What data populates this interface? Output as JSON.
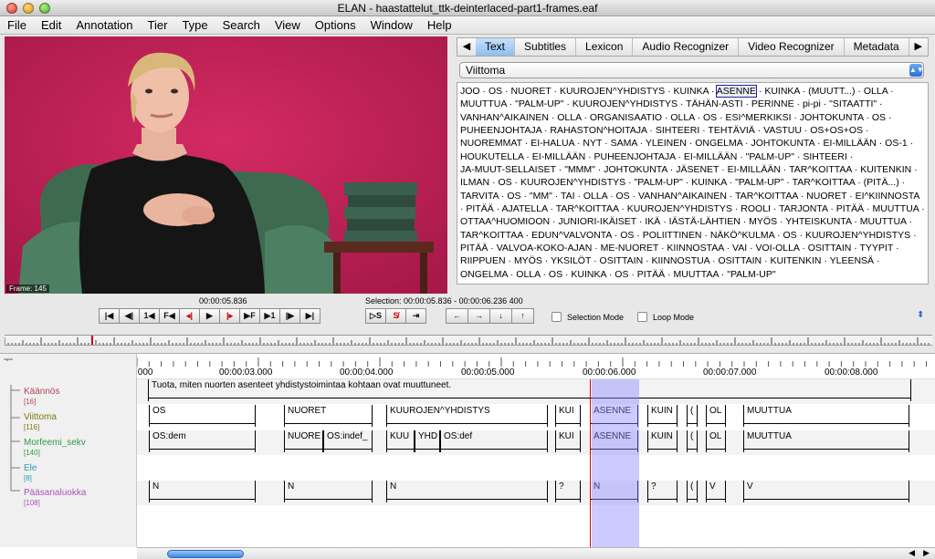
{
  "window": {
    "title": "ELAN - haastattelut_ttk-deinterlaced-part1-frames.eaf"
  },
  "menu": [
    "File",
    "Edit",
    "Annotation",
    "Tier",
    "Type",
    "Search",
    "View",
    "Options",
    "Window",
    "Help"
  ],
  "video": {
    "frame_label": "Frame: 145"
  },
  "tabs": {
    "items": [
      "Text",
      "Subtitles",
      "Lexicon",
      "Audio Recognizer",
      "Video Recognizer",
      "Metadata"
    ],
    "active": "Text"
  },
  "tier_select": {
    "value": "Viittoma"
  },
  "text_view": {
    "highlighted": "ASENNE",
    "words": [
      "JOO",
      "OS",
      "NUORET",
      "KUUROJEN^YHDISTYS",
      "KUINKA",
      "ASENNE",
      "KUINKA",
      "(MUUTT...)",
      "OLLA",
      "MUUTTUA",
      "\"PALM-UP\"",
      "KUUROJEN^YHDISTYS",
      "TÄHÄN-ASTI",
      "PERINNE",
      "pi-pi",
      "\"SITAATTI\"",
      "VANHAN^AIKAINEN",
      "OLLA",
      "ORGANISAATIO",
      "OLLA",
      "OS",
      "ESI^MERKIKSI",
      "JOHTOKUNTA",
      "OS",
      "PUHEENJOHTAJA",
      "RAHASTON^HOITAJA",
      "SIHTEERI",
      "TEHTÄVIÄ",
      "VASTUU",
      "OS+OS+OS",
      "NUOREMMAT",
      "EI-HALUA",
      "NYT",
      "SAMA",
      "YLEINEN",
      "ONGELMA",
      "JOHTOKUNTA",
      "EI-MILLÄÄN",
      "OS-1",
      "HOUKUTELLA",
      "EI-MILLÄÄN",
      "PUHEENJOHTAJA",
      "EI-MILLÄÄN",
      "\"PALM-UP\"",
      "SIHTEERI",
      "JA-MUUT-SELLAISET",
      "\"MMM\"",
      "JOHTOKUNTA",
      "JÄSENET",
      "EI-MILLÄÄN",
      "TAR^KOITTAA",
      "KUITENKIN",
      "ILMAN",
      "OS",
      "KUUROJEN^YHDISTYS",
      "\"PALM-UP\"",
      "KUINKA",
      "\"PALM-UP\"",
      "TAR^KOITTAA",
      "(PITÄ...)",
      "TARVITA",
      "OS",
      "\"MM\"",
      "TAI",
      "OLLA",
      "OS",
      "VANHAN^AIKAINEN",
      "TAR^KOITTAA",
      "NUORET",
      "EI^KIINNOSTA",
      "PITÄÄ",
      "AJATELLA",
      "TAR^KOITTAA",
      "KUUROJEN^YHDISTYS",
      "ROOLI",
      "TARJONTA",
      "PITÄÄ",
      "MUUTTUA",
      "OTTAA^HUOMIOON",
      "JUNIORI-IKÄISET",
      "IKÄ",
      "IÄSTÄ-LÄHTIEN",
      "MYÖS",
      "YHTEISKUNTA",
      "MUUTTUA",
      "TAR^KOITTAA",
      "EDUN^VALVONTA",
      "OS",
      "POLIITTINEN",
      "NÄKÖ^KULMA",
      "OS",
      "KUUROJEN^YHDISTYS",
      "PITÄÄ",
      "VALVOA-KOKO-AJAN",
      "ME-NUORET",
      "KIINNOSTAA",
      "VAI",
      "VOI-OLLA",
      "OSITTAIN",
      "TYYPIT",
      "RIIPPUEN",
      "MYÖS",
      "YKSILÖT",
      "OSITTAIN",
      "KIINNOSTUA",
      "OSITTAIN",
      "KUITENKIN",
      "YLEENSÄ",
      "ONGELMA",
      "OLLA",
      "OS",
      "KUINKA",
      "OS",
      "PITÄÄ",
      "MUUTTAA",
      "\"PALM-UP\""
    ]
  },
  "media": {
    "current_time": "00:00:05.836",
    "selection": "Selection: 00:00:05.836 - 00:00:06.236  400"
  },
  "controls": {
    "playback": [
      "⏮",
      "◀|",
      "1◀",
      "F◀",
      "◂|",
      "▶",
      "|▸",
      "▶F",
      "▶1",
      "|▶",
      "▶|"
    ],
    "selection": [
      "S",
      "S",
      "⇥"
    ],
    "navigation": [
      "←",
      "→",
      "↓",
      "↑"
    ],
    "selection_mode": "Selection Mode",
    "loop_mode": "Loop Mode"
  },
  "ruler": {
    "ticks": [
      ":000",
      "00:00:03.000",
      "00:00:04.000",
      "00:00:05.000",
      "00:00:06.000",
      "00:00:07.000",
      "00:00:08.000"
    ]
  },
  "tiers": [
    {
      "name": "Käännös",
      "count": "[16]",
      "color": "#b0455a"
    },
    {
      "name": "Viittoma",
      "count": "[116]",
      "color": "#7a7a10"
    },
    {
      "name": "Morfeemi_sekv",
      "count": "[140]",
      "color": "#2d9a4a"
    },
    {
      "name": "Ele",
      "count": "[8]",
      "color": "#2aa0b0"
    },
    {
      "name": "Pääsanaluokka",
      "count": "[108]",
      "color": "#b050c0"
    }
  ],
  "annotations": {
    "kaannos": "Tuota, miten nuorten asenteet yhdistystoimintaa kohtaan ovat muuttuneet.",
    "viittoma": [
      "OS",
      "NUORET",
      "KUUROJEN^YHDISTYS",
      "KUI",
      "ASENNE",
      "KUIN",
      "(",
      "OL",
      "MUUTTUA"
    ],
    "morfeemi": [
      "OS:dem",
      "NUORE",
      "OS:indef_",
      "KUU",
      "YHD",
      "OS:def",
      "KUI",
      "ASENNE",
      "KUIN",
      "(",
      "OL",
      "MUUTTUA"
    ],
    "paasana": [
      "N",
      "N",
      "N",
      "?",
      "N",
      "?",
      "(",
      "V",
      "V"
    ]
  }
}
